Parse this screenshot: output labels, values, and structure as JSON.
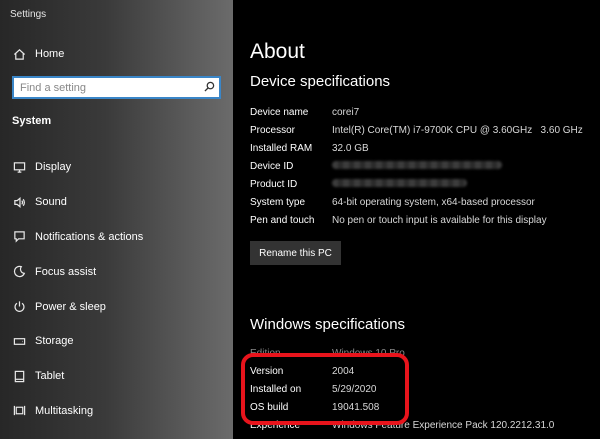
{
  "window": {
    "title": "Settings"
  },
  "sidebar": {
    "home_label": "Home",
    "search_placeholder": "Find a setting",
    "section_title": "System",
    "items": [
      {
        "label": "Display",
        "icon": "monitor-icon"
      },
      {
        "label": "Sound",
        "icon": "speaker-icon"
      },
      {
        "label": "Notifications & actions",
        "icon": "notification-icon"
      },
      {
        "label": "Focus assist",
        "icon": "moon-icon"
      },
      {
        "label": "Power & sleep",
        "icon": "power-icon"
      },
      {
        "label": "Storage",
        "icon": "drive-icon"
      },
      {
        "label": "Tablet",
        "icon": "tablet-icon"
      },
      {
        "label": "Multitasking",
        "icon": "multitasking-icon"
      }
    ]
  },
  "main": {
    "title": "About",
    "device_heading": "Device specifications",
    "device_specs": [
      {
        "label": "Device name",
        "value": "corei7"
      },
      {
        "label": "Processor",
        "value": "Intel(R) Core(TM) i7-9700K CPU @ 3.60GHz   3.60 GHz"
      },
      {
        "label": "Installed RAM",
        "value": "32.0 GB"
      },
      {
        "label": "Device ID",
        "value": ""
      },
      {
        "label": "Product ID",
        "value": ""
      },
      {
        "label": "System type",
        "value": "64-bit operating system, x64-based processor"
      },
      {
        "label": "Pen and touch",
        "value": "No pen or touch input is available for this display"
      }
    ],
    "rename_label": "Rename this PC",
    "windows_heading": "Windows specifications",
    "windows_specs": [
      {
        "label": "Edition",
        "value": "Windows 10 Pro"
      },
      {
        "label": "Version",
        "value": "2004"
      },
      {
        "label": "Installed on",
        "value": "5/29/2020"
      },
      {
        "label": "OS build",
        "value": "19041.508"
      },
      {
        "label": "Experience",
        "value": "Windows Feature Experience Pack 120.2212.31.0"
      }
    ]
  },
  "colors": {
    "highlight": "#e8141c",
    "search_border": "#3a86c8"
  }
}
